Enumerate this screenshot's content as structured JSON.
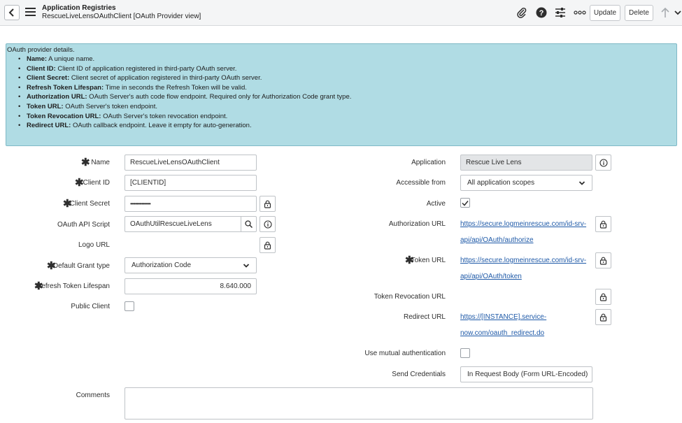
{
  "header": {
    "title": "Application Registries",
    "subtitle": "RescueLiveLensOAuthClient [OAuth Provider view]",
    "update_label": "Update",
    "delete_label": "Delete"
  },
  "info": {
    "intro": "OAuth provider details.",
    "items": [
      {
        "term": "Name:",
        "desc": " A unique name."
      },
      {
        "term": "Client ID:",
        "desc": " Client ID of application registered in third-party OAuth server."
      },
      {
        "term": "Client Secret:",
        "desc": " Client secret of application registered in third-party OAuth server."
      },
      {
        "term": "Refresh Token Lifespan:",
        "desc": " Time in seconds the Refresh Token will be valid."
      },
      {
        "term": "Authorization URL:",
        "desc": " OAuth Server's auth code flow endpoint. Required only for Authorization Code grant type."
      },
      {
        "term": "Token URL:",
        "desc": " OAuth Server's token endpoint."
      },
      {
        "term": "Token Revocation URL:",
        "desc": " OAuth Server's token revocation endpoint."
      },
      {
        "term": "Redirect URL:",
        "desc": " OAuth callback endpoint. Leave it empty for auto-generation."
      }
    ]
  },
  "form": {
    "name": {
      "label": "Name",
      "value": "RescueLiveLensOAuthClient"
    },
    "client_id": {
      "label": "Client ID",
      "value": "[CLIENTID]"
    },
    "client_secret": {
      "label": "Client Secret",
      "value": "••••••••••••••••"
    },
    "oauth_api_script": {
      "label": "OAuth API Script",
      "value": "OAuthUtilRescueLiveLens"
    },
    "logo_url": {
      "label": "Logo URL"
    },
    "default_grant_type": {
      "label": "Default Grant type",
      "value": "Authorization Code"
    },
    "refresh_token_lifespan": {
      "label": "Refresh Token Lifespan",
      "value": "8.640.000"
    },
    "public_client": {
      "label": "Public Client"
    },
    "application": {
      "label": "Application",
      "value": "Rescue Live Lens"
    },
    "accessible_from": {
      "label": "Accessible from",
      "value": "All application scopes"
    },
    "active": {
      "label": "Active",
      "checked": true
    },
    "authorization_url": {
      "label": "Authorization URL",
      "line1": "https://secure.logmeinrescue.com/id-srv-",
      "line2": "api/api/OAuth/authorize"
    },
    "token_url": {
      "label": "Token URL",
      "line1": "https://secure.logmeinrescue.com/id-srv-",
      "line2": "api/api/OAuth/token"
    },
    "token_revocation_url": {
      "label": "Token Revocation URL"
    },
    "redirect_url": {
      "label": "Redirect URL",
      "line1": "https://[INSTANCE].service-",
      "line2": "now.com/oauth_redirect.do"
    },
    "mutual_auth": {
      "label": "Use mutual authentication"
    },
    "send_credentials": {
      "label": "Send Credentials",
      "value": "In Request Body (Form URL-Encoded)"
    },
    "comments": {
      "label": "Comments"
    }
  },
  "colors": {
    "info_bg": "#b0dce4",
    "link": "#1f5aa8",
    "readonly_bg": "#e3e5e7"
  },
  "icons": {
    "back": "chevron-left-icon",
    "menu": "hamburger-icon",
    "attachment": "paperclip-icon",
    "help": "question-icon",
    "settings": "sliders-icon",
    "more": "more-icon",
    "up": "arrow-up-icon",
    "dropdown": "chevron-down-icon",
    "lock": "lock-icon",
    "search": "search-icon",
    "info": "info-icon",
    "check": "check-icon"
  }
}
